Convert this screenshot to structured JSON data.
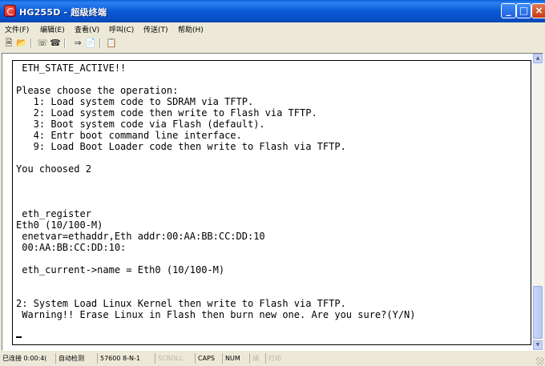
{
  "window": {
    "title": "HG255D - 超级终端"
  },
  "title_buttons": {
    "minimize": "_",
    "maximize": "□",
    "close": "×"
  },
  "menu": [
    "文件(F)",
    "编辑(E)",
    "查看(V)",
    "呼叫(C)",
    "传送(T)",
    "帮助(H)"
  ],
  "toolbar": [
    "new-icon",
    "open-icon",
    "disconnect-icon",
    "call-icon",
    "send-icon",
    "receive-icon",
    "properties-icon"
  ],
  "terminal": {
    "lines": [
      " ETH_STATE_ACTIVE!!",
      "",
      "Please choose the operation:",
      "   1: Load system code to SDRAM via TFTP.",
      "   2: Load system code then write to Flash via TFTP.",
      "   3: Boot system code via Flash (default).",
      "   4: Entr boot command line interface.",
      "   9: Load Boot Loader code then write to Flash via TFTP.",
      "",
      "You choosed 2",
      "",
      "",
      "",
      " eth_register",
      "Eth0 (10/100-M)",
      " enetvar=ethaddr,Eth addr:00:AA:BB:CC:DD:10",
      " 00:AA:BB:CC:DD:10:",
      "",
      " eth_current->name = Eth0 (10/100-M)",
      "",
      "",
      "2: System Load Linux Kernel then write to Flash via TFTP.",
      " Warning!! Erase Linux in Flash then burn new one. Are you sure?(Y/N)"
    ]
  },
  "status": {
    "connected": "已连接 0:00:4(",
    "detect": "自动检测",
    "port": "57600 8-N-1",
    "scroll": "SCROLL",
    "caps": "CAPS",
    "num": "NUM",
    "capture": "捕",
    "print": "打印"
  }
}
